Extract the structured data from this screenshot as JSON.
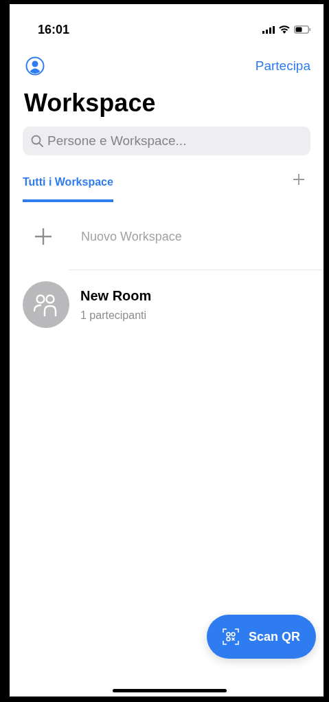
{
  "status_bar": {
    "time": "16:01"
  },
  "nav": {
    "join_label": "Partecipa"
  },
  "title": "Workspace",
  "search": {
    "placeholder": "Persone e Workspace..."
  },
  "tabs": [
    {
      "label": "Tutti i Workspace",
      "selected": true
    }
  ],
  "new_item": {
    "label": "Nuovo Workspace"
  },
  "rooms": [
    {
      "name": "New Room",
      "subtitle": "1 partecipanti"
    }
  ],
  "fab": {
    "label": "Scan QR"
  }
}
